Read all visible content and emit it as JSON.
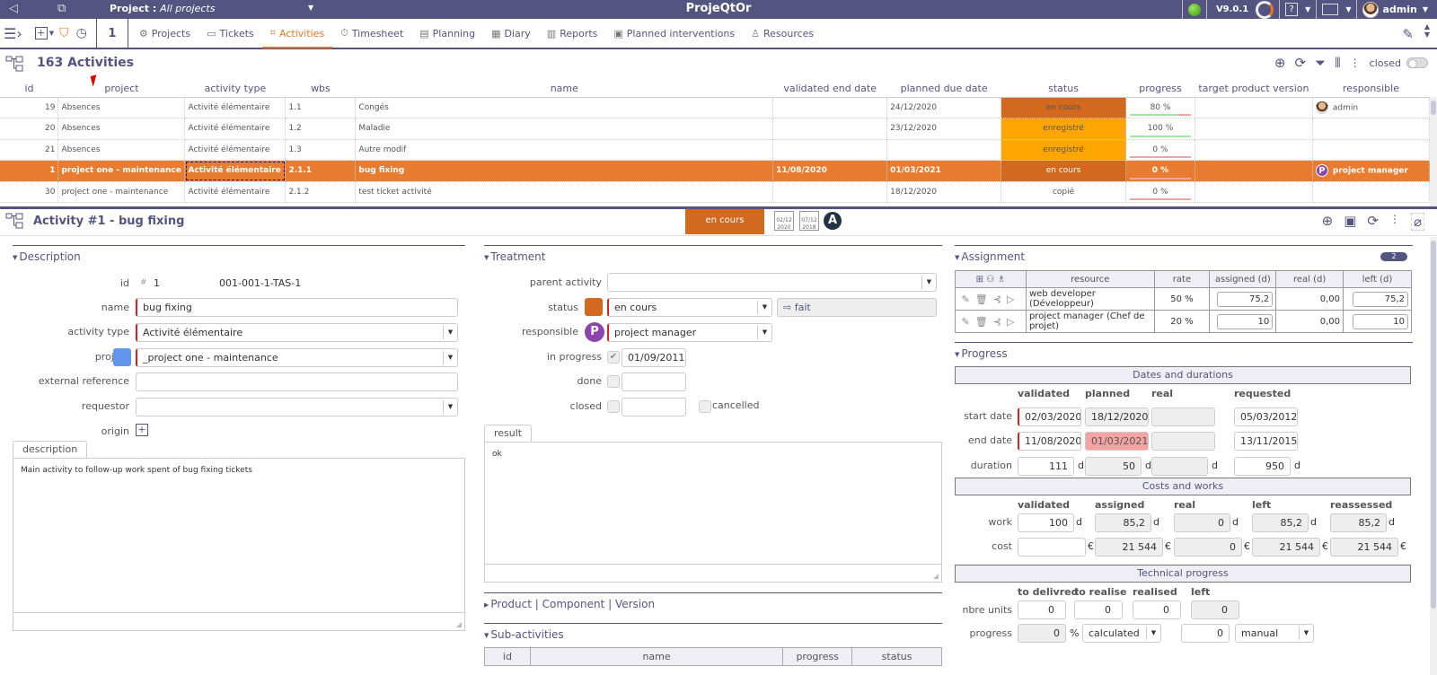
{
  "topbar": {
    "project_label": "Project :",
    "project_value": "All projects",
    "app_title": "ProjeQtOr",
    "version": "V9.0.1",
    "help": "?",
    "user": "admin"
  },
  "navbar": {
    "counter": "1",
    "items": [
      {
        "label": "Projects",
        "icon": "gear-icon",
        "glyph": "⚙",
        "active": false
      },
      {
        "label": "Tickets",
        "icon": "ticket-icon",
        "glyph": "▭",
        "active": false
      },
      {
        "label": "Activities",
        "icon": "activity-icon",
        "glyph": "⌗",
        "active": true
      },
      {
        "label": "Timesheet",
        "icon": "stopwatch-icon",
        "glyph": "⏱",
        "active": false
      },
      {
        "label": "Planning",
        "icon": "planning-icon",
        "glyph": "▤",
        "active": false
      },
      {
        "label": "Diary",
        "icon": "calendar-icon",
        "glyph": "▦",
        "active": false
      },
      {
        "label": "Reports",
        "icon": "reports-icon",
        "glyph": "▥",
        "active": false
      },
      {
        "label": "Planned interventions",
        "icon": "intervention-icon",
        "glyph": "▣",
        "active": false
      },
      {
        "label": "Resources",
        "icon": "resource-icon",
        "glyph": "♙",
        "active": false
      }
    ]
  },
  "list": {
    "title": "163 Activities",
    "closed_label": "closed",
    "columns": [
      "id",
      "project",
      "activity type",
      "wbs",
      "name",
      "validated end date",
      "planned due date",
      "status",
      "progress",
      "target product version",
      "responsible"
    ],
    "rows": [
      {
        "id": "19",
        "project": "Absences",
        "type": "Activité élémentaire",
        "wbs": "1.1",
        "name": "Congés",
        "validated_end": "",
        "planned_due": "24/12/2020",
        "status": "en cours",
        "status_color": "#d2691e",
        "progress_label": "80 %",
        "progress": 80,
        "target_version": "",
        "responsible": "admin",
        "resp_avatar": "photo",
        "selected": false
      },
      {
        "id": "20",
        "project": "Absences",
        "type": "Activité élémentaire",
        "wbs": "1.2",
        "name": "Maladie",
        "validated_end": "",
        "planned_due": "23/12/2020",
        "status": "enregistré",
        "status_color": "#ffa500",
        "progress_label": "100 %",
        "progress": 100,
        "target_version": "",
        "responsible": "",
        "resp_avatar": "",
        "selected": false
      },
      {
        "id": "21",
        "project": "Absences",
        "type": "Activité élémentaire",
        "wbs": "1.3",
        "name": "Autre modif",
        "validated_end": "",
        "planned_due": "",
        "status": "enregistré",
        "status_color": "#ffa500",
        "progress_label": "0 %",
        "progress": 0,
        "target_version": "",
        "responsible": "",
        "resp_avatar": "",
        "selected": false
      },
      {
        "id": "1",
        "project": "project one - maintenance",
        "type": "Activité élémentaire",
        "wbs": "2.1.1",
        "name": "bug fixing",
        "validated_end": "11/08/2020",
        "planned_due": "01/03/2021",
        "status": "en cours",
        "status_color": "#d2691e",
        "progress_label": "0 %",
        "progress": 0,
        "target_version": "",
        "responsible": "project manager",
        "resp_avatar": "P",
        "selected": true
      },
      {
        "id": "30",
        "project": "project one - maintenance",
        "type": "Activité élémentaire",
        "wbs": "2.1.2",
        "name": "test ticket activité",
        "validated_end": "",
        "planned_due": "18/12/2020",
        "status": "copié",
        "status_color": "",
        "progress_label": "0 %",
        "progress": 0,
        "target_version": "",
        "responsible": "",
        "resp_avatar": "",
        "selected": false
      }
    ]
  },
  "detail": {
    "title": "Activity  #1  - bug fixing",
    "status_badge": "en cours",
    "status_color": "#d2691e",
    "cal1": "02/12\n2020",
    "cal1_top": "02/12",
    "cal1_bottom": "2020",
    "cal2_top": "07/12",
    "cal2_bottom": "2018",
    "avatar_letter": "A",
    "description": {
      "title": "Description",
      "id_label": "id",
      "id_hash": "#",
      "id_value": "1",
      "reference": "001-001-1-TAS-1",
      "name_label": "name",
      "name_value": "bug fixing",
      "type_label": "activity type",
      "type_value": "Activité élémentaire",
      "project_label": "project",
      "project_value": "_project one - maintenance",
      "project_color": "#6495ed",
      "extref_label": "external reference",
      "extref_value": "",
      "requestor_label": "requestor",
      "requestor_value": "",
      "origin_label": "origin",
      "desc_tab": "description",
      "desc_text": "Main activity to follow-up work spent of bug fixing tickets"
    },
    "treatment": {
      "title": "Treatment",
      "parent_label": "parent activity",
      "parent_value": "",
      "status_label": "status",
      "status_value": "en cours",
      "status_color": "#d2691e",
      "next_status": "fait",
      "responsible_label": "responsible",
      "responsible_value": "project manager",
      "responsible_letter": "P",
      "inprogress_label": "in progress",
      "inprogress_checked": true,
      "inprogress_date": "01/09/2011",
      "done_label": "done",
      "done_date": "",
      "closed_label": "closed",
      "closed_date": "",
      "cancelled_label": "cancelled",
      "result_tab": "result",
      "result_text": "ok",
      "pcv_title": "Product | Component | Version",
      "sub_title": "Sub-activities",
      "sub_columns": [
        "id",
        "name",
        "progress",
        "status"
      ]
    },
    "assignment": {
      "title": "Assignment",
      "count": "2",
      "columns": [
        "resource",
        "rate",
        "assigned (d)",
        "real (d)",
        "left (d)"
      ],
      "rows": [
        {
          "resource": "web developer (Développeur)",
          "rate": "50 %",
          "assigned": "75,2",
          "real": "0,00",
          "left": "75,2"
        },
        {
          "resource": "project manager (Chef de projet)",
          "rate": "20 %",
          "assigned": "10",
          "real": "0,00",
          "left": "10"
        }
      ]
    },
    "progress": {
      "title": "Progress",
      "dates_band": "Dates and durations",
      "dates_cols": [
        "validated",
        "planned",
        "real",
        "requested"
      ],
      "start_label": "start date",
      "end_label": "end date",
      "duration_label": "duration",
      "start": {
        "validated": "02/03/2020",
        "planned": "18/12/2020",
        "real": "",
        "requested": "05/03/2012"
      },
      "end": {
        "validated": "11/08/2020",
        "planned": "01/03/2021",
        "real": "",
        "requested": "13/11/2015"
      },
      "duration": {
        "validated": "111",
        "planned": "50",
        "real": "",
        "requested": "950"
      },
      "day_unit": "d",
      "costs_band": "Costs and works",
      "costs_cols": [
        "validated",
        "assigned",
        "real",
        "left",
        "reassessed"
      ],
      "work_label": "work",
      "cost_label": "cost",
      "work": {
        "validated": "100",
        "assigned": "85,2",
        "real": "0",
        "left": "85,2",
        "reassessed": "85,2"
      },
      "cost": {
        "validated": "",
        "assigned": "21 544",
        "real": "0",
        "left": "21 544",
        "reassessed": "21 544"
      },
      "currency": "€",
      "tech_band": "Technical progress",
      "tech_cols": [
        "to delivred",
        "to realise",
        "realised",
        "left"
      ],
      "units_label": "nbre units",
      "units": {
        "to_deliver": "0",
        "to_realise": "0",
        "realised": "0",
        "left": "0"
      },
      "progress_label": "progress",
      "progress_value": "0",
      "percent": "%",
      "progress_mode": "calculated",
      "progress_manual_value": "0",
      "progress_manual_mode": "manual"
    }
  }
}
